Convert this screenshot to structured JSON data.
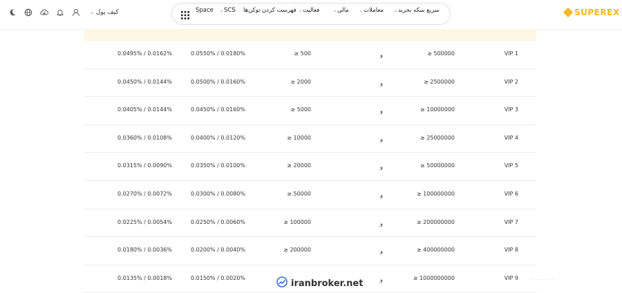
{
  "header": {
    "wallet_label": "کیف پول",
    "nav": {
      "quick_buy": "سریع سکه بخرید",
      "trading": "معاملات",
      "finance": "مالی",
      "activity": "فعالیت",
      "token_listing": "فهرست کردن توکن‌ها",
      "scs": "SCS",
      "space": "Space"
    },
    "logo_text": "SUPEREX",
    "icons": [
      "moon-icon",
      "globe-icon",
      "download-icon",
      "bell-icon",
      "user-icon"
    ]
  },
  "vip_table": {
    "rows": [
      {
        "level": "VIP 1",
        "asset": "≥ 500000",
        "join": "و",
        "volume": "≥ 500",
        "fee_a": "0.0550% / 0.0180%",
        "fee_b": "0.0495% / 0.0162%"
      },
      {
        "level": "VIP 2",
        "asset": "≥ 2500000",
        "join": "و",
        "volume": "≥ 2000",
        "fee_a": "0.0500% / 0.0160%",
        "fee_b": "0.0450% / 0.0144%"
      },
      {
        "level": "VIP 3",
        "asset": "≥ 10000000",
        "join": "و",
        "volume": "≥ 5000",
        "fee_a": "0.0450% / 0.0160%",
        "fee_b": "0.0405% / 0.0144%"
      },
      {
        "level": "VIP 4",
        "asset": "≥ 25000000",
        "join": "و",
        "volume": "≥ 10000",
        "fee_a": "0.0400% / 0.0120%",
        "fee_b": "0.0360% / 0.0108%"
      },
      {
        "level": "VIP 5",
        "asset": "≥ 50000000",
        "join": "و",
        "volume": "≥ 20000",
        "fee_a": "0.0350% / 0.0100%",
        "fee_b": "0.0315% / 0.0090%"
      },
      {
        "level": "VIP 6",
        "asset": "≥ 100000000",
        "join": "و",
        "volume": "≥ 50000",
        "fee_a": "0.0300% / 0.0080%",
        "fee_b": "0.0270% / 0.0072%"
      },
      {
        "level": "VIP 7",
        "asset": "≥ 200000000",
        "join": "و",
        "volume": "≥ 100000",
        "fee_a": "0.0250% / 0.0060%",
        "fee_b": "0.0225% / 0.0054%"
      },
      {
        "level": "VIP 8",
        "asset": "≥ 400000000",
        "join": "و",
        "volume": "≥ 200000",
        "fee_a": "0.0200% / 0.0040%",
        "fee_b": "0.0180% / 0.0036%"
      },
      {
        "level": "VIP 9",
        "asset": "≥ 1000000000",
        "join": "و",
        "volume": "",
        "fee_a": "0.0150% / 0.0020%",
        "fee_b": "0.0135% / 0.0018%"
      }
    ]
  },
  "watermark": {
    "text": "iranbroker.net"
  }
}
